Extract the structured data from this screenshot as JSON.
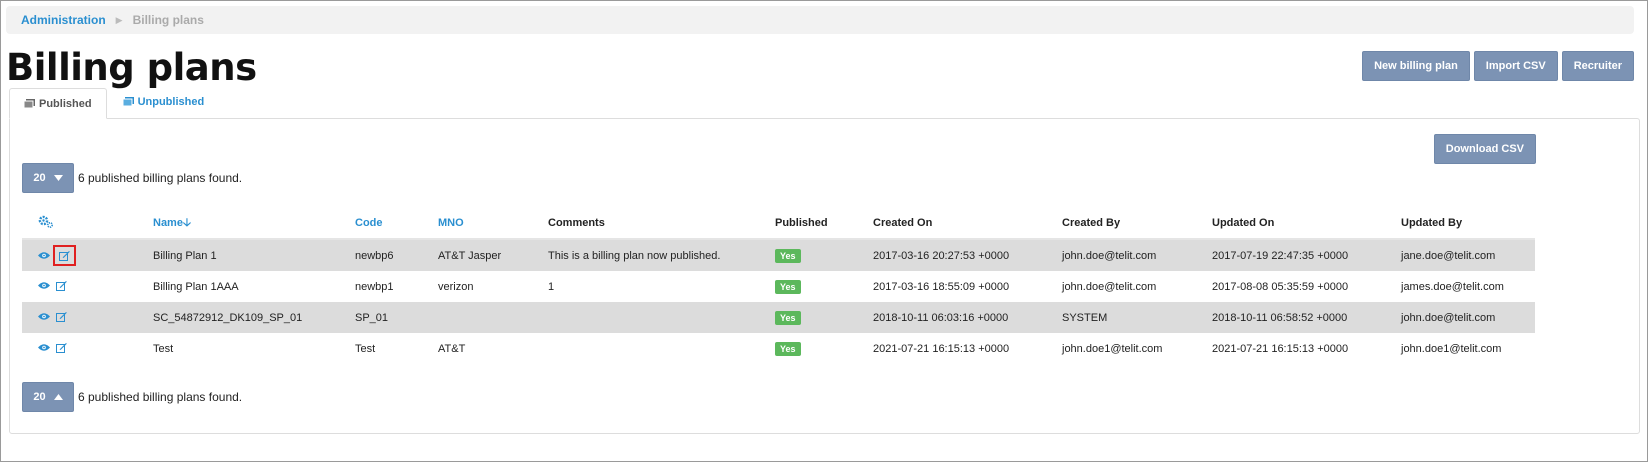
{
  "breadcrumb": {
    "root": "Administration",
    "current": "Billing plans"
  },
  "page": {
    "title": "Billing plans"
  },
  "actions": {
    "new": "New billing plan",
    "import": "Import CSV",
    "recruiter": "Recruiter"
  },
  "tabs": {
    "published": "Published",
    "unpublished": "Unpublished"
  },
  "download": "Download CSV",
  "pager": {
    "page_size": "20",
    "summary": "6 published billing plans found."
  },
  "table": {
    "columns": {
      "name": "Name",
      "code": "Code",
      "mno": "MNO",
      "comments": "Comments",
      "published": "Published",
      "created_on": "Created On",
      "created_by": "Created By",
      "updated_on": "Updated On",
      "updated_by": "Updated By"
    },
    "rows": [
      {
        "name": "Billing Plan 1",
        "code": "newbp6",
        "mno": "AT&T Jasper",
        "comments": "This is a billing plan now published.",
        "published": "Yes",
        "created_on": "2017-03-16 20:27:53 +0000",
        "created_by": "john.doe@telit.com",
        "updated_on": "2017-07-19 22:47:35 +0000",
        "updated_by": "jane.doe@telit.com"
      },
      {
        "name": "Billing Plan 1AAA",
        "code": "newbp1",
        "mno": "verizon",
        "comments": "1",
        "published": "Yes",
        "created_on": "2017-03-16 18:55:09 +0000",
        "created_by": "john.doe@telit.com",
        "updated_on": "2017-08-08 05:35:59 +0000",
        "updated_by": "james.doe@telit.com"
      },
      {
        "name": "SC_54872912_DK109_SP_01",
        "code": "SP_01",
        "mno": "",
        "comments": "",
        "published": "Yes",
        "created_on": "2018-10-11 06:03:16 +0000",
        "created_by": "SYSTEM",
        "updated_on": "2018-10-11 06:58:52 +0000",
        "updated_by": "john.doe@telit.com"
      },
      {
        "name": "Test",
        "code": "Test",
        "mno": "AT&T",
        "comments": "",
        "published": "Yes",
        "created_on": "2021-07-21 16:15:13 +0000",
        "created_by": "john.doe1@telit.com",
        "updated_on": "2021-07-21 16:15:13 +0000",
        "updated_by": "john.doe1@telit.com"
      }
    ]
  },
  "colors": {
    "accent": "#2a8fd0",
    "button": "#7c93b4",
    "badge": "#5cb85c",
    "highlight": "#e02020"
  },
  "icons": {
    "settings": "cogs-icon",
    "view": "eye-icon",
    "edit": "edit-icon",
    "tab": "copy-icon"
  }
}
